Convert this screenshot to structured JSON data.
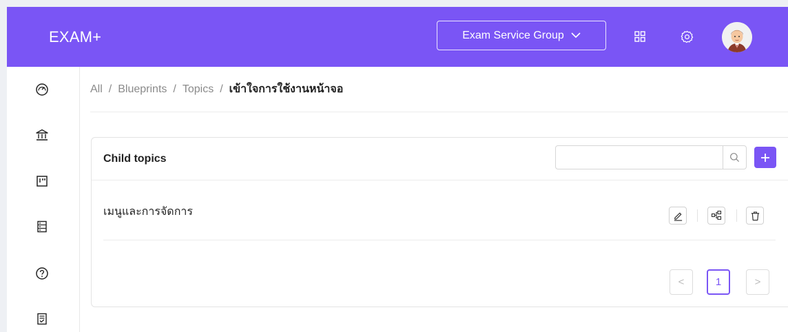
{
  "header": {
    "logo": "EXAM+",
    "group_select": {
      "label": "Exam Service Group"
    },
    "icons": [
      "apps-grid-icon",
      "settings-gear-icon",
      "user-avatar"
    ]
  },
  "sidebar": {
    "items": [
      {
        "icon": "dashboard-gauge-icon"
      },
      {
        "icon": "institution-bank-icon"
      },
      {
        "icon": "board-icon"
      },
      {
        "icon": "list-document-icon"
      },
      {
        "icon": "help-question-icon"
      },
      {
        "icon": "exam-paper-icon"
      }
    ]
  },
  "breadcrumb": {
    "items": [
      "All",
      "Blueprints",
      "Topics"
    ],
    "separator": "/",
    "current": "เข้าใจการใช้งานหน้าจอ"
  },
  "card": {
    "title": "Child topics",
    "search": {
      "value": "",
      "placeholder": ""
    },
    "rows": [
      {
        "label": "เมนูและการจัดการ",
        "actions": [
          "edit-pencil-icon",
          "sub-topics-tree-icon",
          "delete-trash-icon"
        ]
      }
    ]
  },
  "pagination": {
    "prev": "<",
    "pages": [
      "1"
    ],
    "current": "1",
    "next": ">"
  },
  "colors": {
    "accent": "#7a55f5",
    "page_bg": "#eef0f4",
    "text": "#222222",
    "muted": "#8a8a8a"
  }
}
